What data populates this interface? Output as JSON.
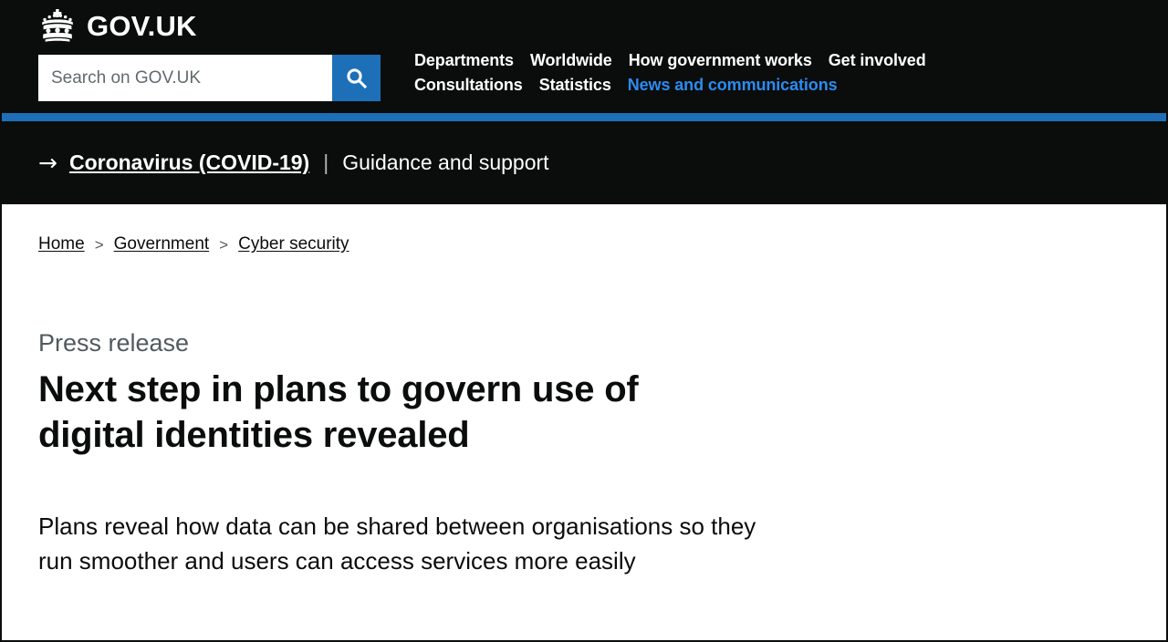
{
  "colors": {
    "black": "#0b0c0c",
    "blue": "#1d70b8",
    "link_blue": "#2b8cf0",
    "grey_text": "#505a5f",
    "placeholder_grey": "#626a6e"
  },
  "header": {
    "logo_text": "GOV.UK",
    "crown_icon": "crown-icon",
    "search": {
      "placeholder": "Search on GOV.UK",
      "value": "",
      "button_icon": "search-icon"
    },
    "nav_row_one": [
      {
        "label": "Departments",
        "active": false
      },
      {
        "label": "Worldwide",
        "active": false
      },
      {
        "label": "How government works",
        "active": false
      },
      {
        "label": "Get involved",
        "active": false
      }
    ],
    "nav_row_two": [
      {
        "label": "Consultations",
        "active": false
      },
      {
        "label": "Statistics",
        "active": false
      },
      {
        "label": "News and communications",
        "active": true
      }
    ]
  },
  "covid_banner": {
    "arrow_icon": "arrow-right-icon",
    "link_label": "Coronavirus (COVID-19)",
    "separator": "|",
    "sub_label": "Guidance and support"
  },
  "breadcrumbs": {
    "separator": ">",
    "items": [
      {
        "label": "Home"
      },
      {
        "label": "Government"
      },
      {
        "label": "Cyber security"
      }
    ]
  },
  "article": {
    "document_type": "Press release",
    "title": "Next step in plans to govern use of digital identities revealed",
    "summary": "Plans reveal how data can be shared between organisations so they run smoother and users can access services more easily"
  }
}
